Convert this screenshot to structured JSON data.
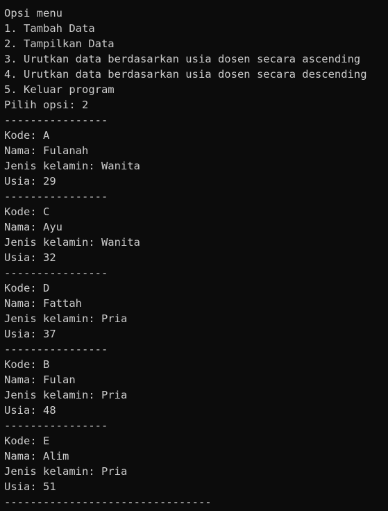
{
  "theme": {
    "background": "#0c0c0c",
    "foreground": "#cccccc"
  },
  "console": {
    "lines": [
      "Opsi menu",
      "1. Tambah Data",
      "2. Tampilkan Data",
      "3. Urutkan data berdasarkan usia dosen secara ascending",
      "4. Urutkan data berdasarkan usia dosen secara descending",
      "5. Keluar program",
      "Pilih opsi: 2",
      "----------------",
      "Kode: A",
      "Nama: Fulanah",
      "Jenis kelamin: Wanita",
      "Usia: 29",
      "----------------",
      "Kode: C",
      "Nama: Ayu",
      "Jenis kelamin: Wanita",
      "Usia: 32",
      "----------------",
      "Kode: D",
      "Nama: Fattah",
      "Jenis kelamin: Pria",
      "Usia: 37",
      "----------------",
      "Kode: B",
      "Nama: Fulan",
      "Jenis kelamin: Pria",
      "Usia: 48",
      "----------------",
      "Kode: E",
      "Nama: Alim",
      "Jenis kelamin: Pria",
      "Usia: 51",
      "--------------------------------"
    ]
  }
}
